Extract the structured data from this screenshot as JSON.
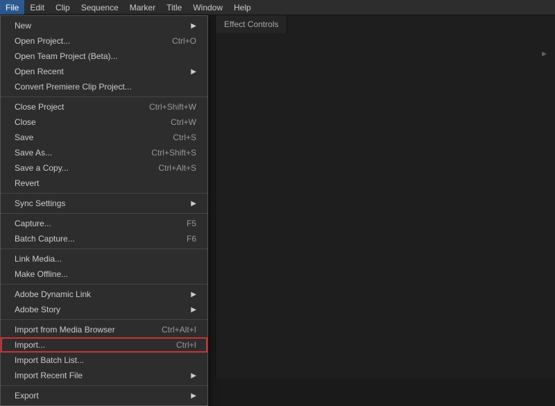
{
  "menubar": {
    "items": [
      {
        "label": "File",
        "active": true
      },
      {
        "label": "Edit"
      },
      {
        "label": "Clip"
      },
      {
        "label": "Sequence"
      },
      {
        "label": "Marker"
      },
      {
        "label": "Title"
      },
      {
        "label": "Window"
      },
      {
        "label": "Help"
      }
    ]
  },
  "file_menu": {
    "sections": [
      {
        "items": [
          {
            "label": "New",
            "shortcut": "",
            "arrow": true,
            "disabled": false
          },
          {
            "label": "Open Project...",
            "shortcut": "Ctrl+O",
            "arrow": false,
            "disabled": false
          },
          {
            "label": "Open Team Project (Beta)...",
            "shortcut": "",
            "arrow": false,
            "disabled": false
          },
          {
            "label": "Open Recent",
            "shortcut": "",
            "arrow": true,
            "disabled": false
          },
          {
            "label": "Convert Premiere Clip Project...",
            "shortcut": "",
            "arrow": false,
            "disabled": false
          }
        ]
      },
      {
        "items": [
          {
            "label": "Close Project",
            "shortcut": "Ctrl+Shift+W",
            "arrow": false,
            "disabled": false
          },
          {
            "label": "Close",
            "shortcut": "Ctrl+W",
            "arrow": false,
            "disabled": false
          },
          {
            "label": "Save",
            "shortcut": "Ctrl+S",
            "arrow": false,
            "disabled": false
          },
          {
            "label": "Save As...",
            "shortcut": "Ctrl+Shift+S",
            "arrow": false,
            "disabled": false
          },
          {
            "label": "Save a Copy...",
            "shortcut": "Ctrl+Alt+S",
            "arrow": false,
            "disabled": false
          },
          {
            "label": "Revert",
            "shortcut": "",
            "arrow": false,
            "disabled": false
          }
        ]
      },
      {
        "items": [
          {
            "label": "Sync Settings",
            "shortcut": "",
            "arrow": true,
            "disabled": false
          }
        ]
      },
      {
        "items": [
          {
            "label": "Capture...",
            "shortcut": "F5",
            "arrow": false,
            "disabled": false
          },
          {
            "label": "Batch Capture...",
            "shortcut": "F6",
            "arrow": false,
            "disabled": false
          }
        ]
      },
      {
        "items": [
          {
            "label": "Link Media...",
            "shortcut": "",
            "arrow": false,
            "disabled": false
          },
          {
            "label": "Make Offline...",
            "shortcut": "",
            "arrow": false,
            "disabled": false
          }
        ]
      },
      {
        "items": [
          {
            "label": "Adobe Dynamic Link",
            "shortcut": "",
            "arrow": true,
            "disabled": false
          },
          {
            "label": "Adobe Story",
            "shortcut": "",
            "arrow": true,
            "disabled": false
          }
        ]
      },
      {
        "items": [
          {
            "label": "Import from Media Browser",
            "shortcut": "Ctrl+Alt+I",
            "arrow": false,
            "disabled": false
          },
          {
            "label": "Import...",
            "shortcut": "Ctrl+I",
            "arrow": false,
            "disabled": false,
            "highlighted": true
          },
          {
            "label": "Import Batch List...",
            "shortcut": "",
            "arrow": false,
            "disabled": false
          },
          {
            "label": "Import Recent File",
            "shortcut": "",
            "arrow": true,
            "disabled": false
          }
        ]
      },
      {
        "items": [
          {
            "label": "Export",
            "shortcut": "",
            "arrow": true,
            "disabled": false
          }
        ]
      }
    ]
  },
  "right_panel": {
    "tab_label": "Effect Controls",
    "timecode": "►"
  }
}
